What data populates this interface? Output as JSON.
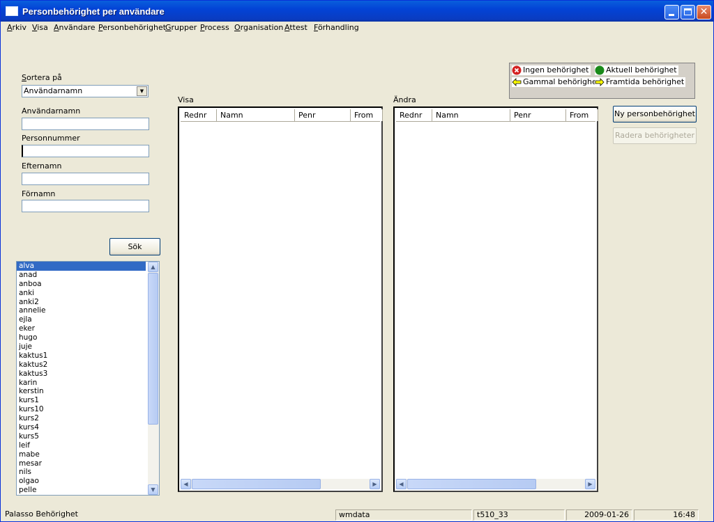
{
  "window": {
    "title": "Personbehörighet per användare"
  },
  "menu": [
    "Arkiv",
    "Visa",
    "Användare",
    "Personbehörighet",
    "Grupper",
    "Process",
    "Organisation",
    "Attest",
    "Förhandling"
  ],
  "search": {
    "sort_label": "Sortera på",
    "sort_value": "Användarnamn",
    "username_label": "Användarnamn",
    "username_value": "",
    "personnummer_label": "Personnummer",
    "personnummer_value": "",
    "efternamn_label": "Efternamn",
    "efternamn_value": "",
    "fornamn_label": "Förnamn",
    "fornamn_value": "",
    "search_button": "Sök"
  },
  "users": [
    "alva",
    "anad",
    "anboa",
    "anki",
    "anki2",
    "annelie",
    "ejla",
    "eker",
    "hugo",
    "juje",
    "kaktus1",
    "kaktus2",
    "kaktus3",
    "karin",
    "kerstin",
    "kurs1",
    "kurs10",
    "kurs2",
    "kurs4",
    "kurs5",
    "leif",
    "mabe",
    "mesar",
    "nils",
    "olgao",
    "pelle"
  ],
  "selected_user": "alva",
  "visa": {
    "label": "Visa",
    "columns": [
      "Rednr",
      "Namn",
      "Penr",
      "From"
    ]
  },
  "andra": {
    "label": "Ändra",
    "columns": [
      "Rednr",
      "Namn",
      "Penr",
      "From"
    ]
  },
  "legend": {
    "ingen": "Ingen behörighet",
    "aktuell": "Aktuell behörighet",
    "gammal": "Gammal behörighet",
    "framtida": "Framtida behörighet"
  },
  "buttons": {
    "new_permission": "Ny personbehörighet",
    "delete_permissions": "Radera behörigheter"
  },
  "status": {
    "app": "Palasso Behörighet",
    "db": "wmdata",
    "server": "t510_33",
    "date": "2009-01-26",
    "time": "16:48"
  },
  "colors": {
    "titlebar": "#0343d6",
    "selection": "#316ac5",
    "error_red": "#d42020",
    "current_green": "#1a8a1a",
    "arrow_yellow": "#ffff00"
  }
}
